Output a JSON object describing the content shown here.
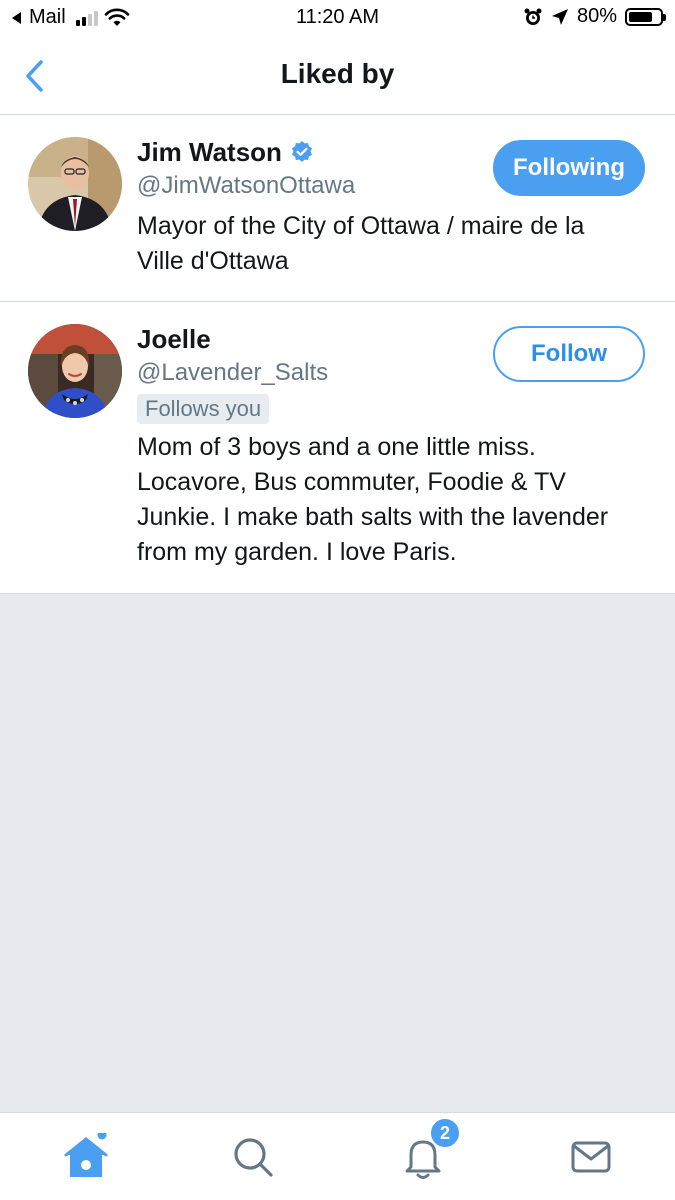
{
  "status_bar": {
    "back_app": "Mail",
    "time": "11:20 AM",
    "battery": "80%",
    "battery_level": 0.8
  },
  "header": {
    "title": "Liked by"
  },
  "users": [
    {
      "name": "Jim Watson",
      "verified": true,
      "handle": "@JimWatsonOttawa",
      "bio": "Mayor of the City of Ottawa / maire de la Ville d'Ottawa",
      "button_label": "Following"
    },
    {
      "name": "Joelle",
      "verified": false,
      "handle": "@Lavender_Salts",
      "follows_you": "Follows you",
      "bio": "Mom of 3 boys and a one little miss. Locavore, Bus commuter, Foodie & TV Junkie. I make bath salts with the lavender from my garden. I love Paris.",
      "button_label": "Follow"
    }
  ],
  "tab_bar": {
    "items": [
      {
        "icon": "home-icon"
      },
      {
        "icon": "search-icon"
      },
      {
        "icon": "bell-icon",
        "badge": "2"
      },
      {
        "icon": "mail-icon"
      }
    ]
  },
  "colors": {
    "accent": "#4a9ff0",
    "secondary_text": "#657786",
    "divider": "#d6dbe0",
    "empty_background": "#e6e9ee"
  }
}
